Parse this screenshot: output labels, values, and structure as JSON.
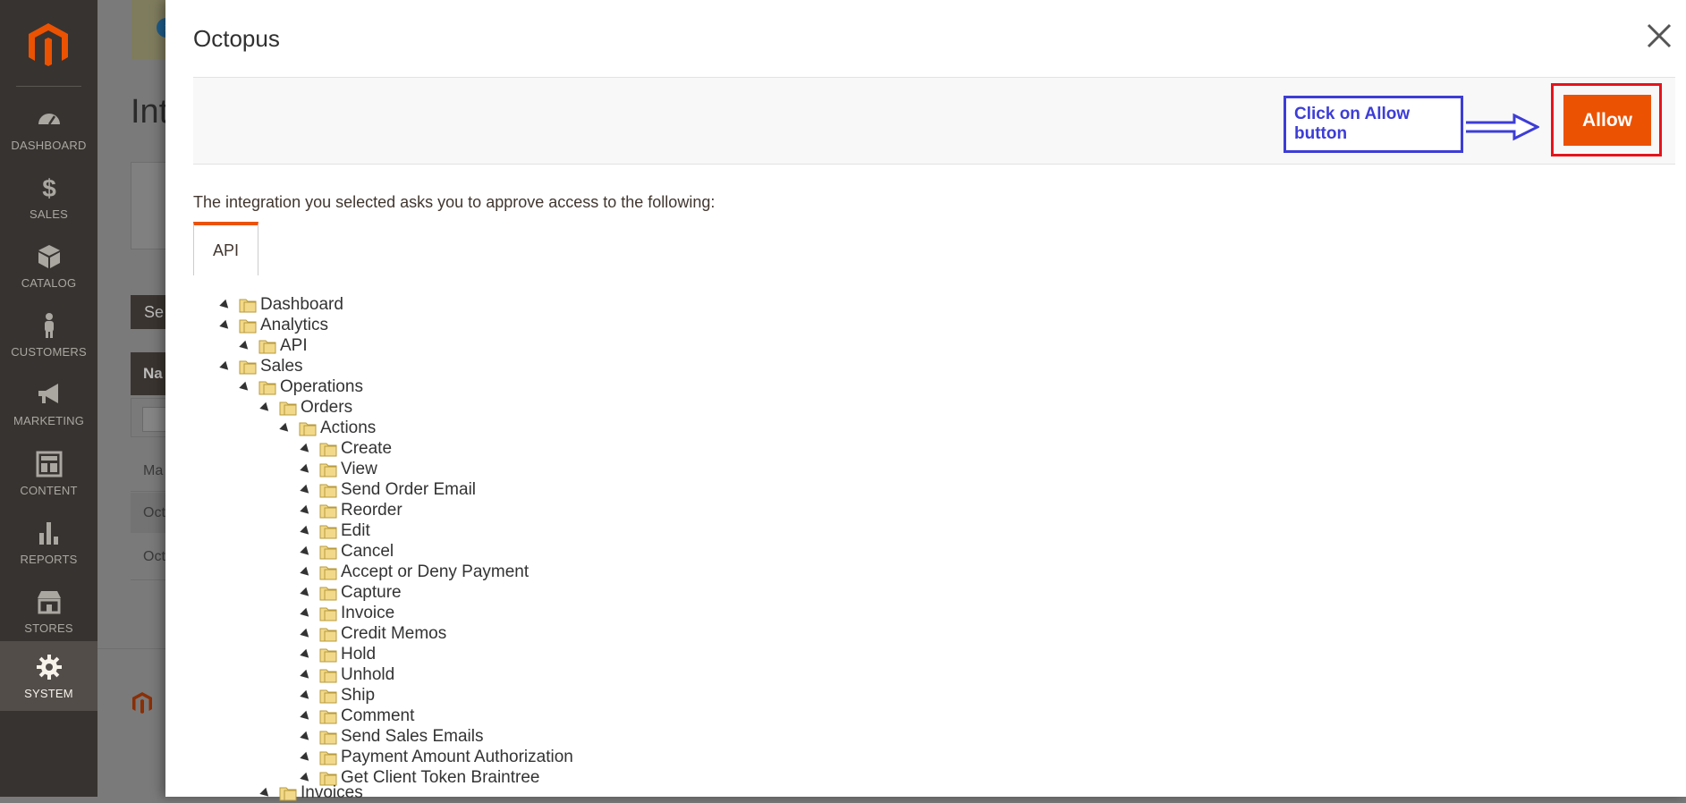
{
  "nav": {
    "items": [
      {
        "label": "DASHBOARD",
        "icon": "dashboard-icon"
      },
      {
        "label": "SALES",
        "icon": "dollar-icon"
      },
      {
        "label": "CATALOG",
        "icon": "box-icon"
      },
      {
        "label": "CUSTOMERS",
        "icon": "person-icon"
      },
      {
        "label": "MARKETING",
        "icon": "megaphone-icon"
      },
      {
        "label": "CONTENT",
        "icon": "layout-icon"
      },
      {
        "label": "REPORTS",
        "icon": "bar-chart-icon"
      },
      {
        "label": "STORES",
        "icon": "storefront-icon"
      },
      {
        "label": "SYSTEM",
        "icon": "gear-icon"
      }
    ],
    "active": "SYSTEM"
  },
  "background_page": {
    "title_fragment": "Int",
    "button_fragment": "Se",
    "table_header_fragment": "Na",
    "rows": [
      "Ma",
      "Oct",
      "Oct"
    ]
  },
  "modal": {
    "title": "Octopus",
    "allow_label": "Allow",
    "annotation": "Click on Allow button",
    "intro": "The integration you selected asks you to approve access to the following:",
    "tab_label": "API",
    "tree": [
      "Dashboard",
      "Analytics",
      "API",
      "Sales",
      "Operations",
      "Orders",
      "Actions",
      "Create",
      "View",
      "Send Order Email",
      "Reorder",
      "Edit",
      "Cancel",
      "Accept or Deny Payment",
      "Capture",
      "Invoice",
      "Credit Memos",
      "Hold",
      "Unhold",
      "Ship",
      "Comment",
      "Send Sales Emails",
      "Payment Amount Authorization",
      "Get Client Token Braintree",
      "Invoices"
    ]
  },
  "colors": {
    "accent": "#eb5202",
    "annotation_blue": "#3d3dd6",
    "annotation_red": "#e5141c",
    "nav_bg": "#373330"
  }
}
